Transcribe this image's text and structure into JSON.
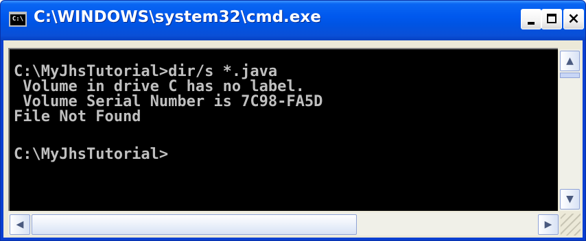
{
  "window": {
    "title": "C:\\WINDOWS\\system32\\cmd.exe",
    "icon_label": "C:\\",
    "icon": "cmd-console-icon",
    "controls": {
      "minimize_icon": "minimize-icon",
      "maximize_icon": "maximize-icon",
      "close_icon": "close-icon",
      "close_glyph": "×"
    }
  },
  "console": {
    "lines": [
      "C:\\MyJhsTutorial>dir/s *.java",
      " Volume in drive C has no label.",
      " Volume Serial Number is 7C98-FA5D",
      "File Not Found",
      "",
      "C:\\MyJhsTutorial>"
    ],
    "background_color": "#000000",
    "text_color": "#c0c0c0"
  },
  "scrollbars": {
    "up_arrow": "▲",
    "down_arrow": "▼",
    "left_arrow": "◀",
    "right_arrow": "▶"
  },
  "colors": {
    "titlebar": "#0054e3",
    "title_text": "#ffffff",
    "frame": "#ece9d8"
  }
}
